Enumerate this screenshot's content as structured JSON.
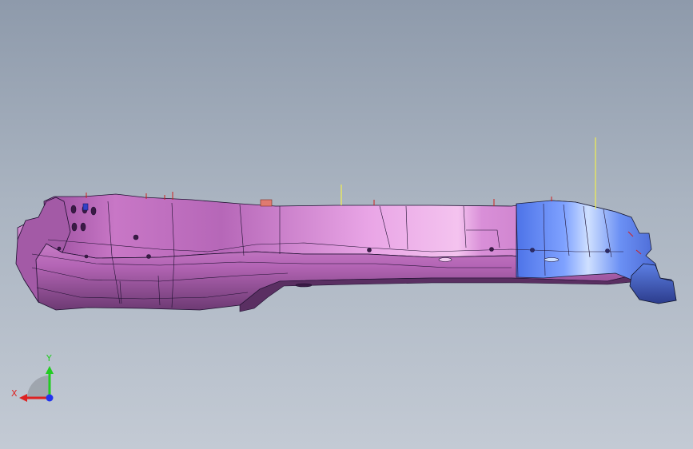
{
  "viewport": {
    "background_top": "#8e9aab",
    "background_bottom": "#c3cad4"
  },
  "model": {
    "body_color": "#cc77cc",
    "highlight_color": "#f2b8f0",
    "end_part_color": "#5f86f0",
    "edge_color": "#1e1030",
    "datum_line_color": "#f2f050",
    "marker_color": "#d02020"
  },
  "triad": {
    "y_label": "Y",
    "x_label": "X",
    "y_color": "#22cc22",
    "x_color": "#dd2222",
    "z_color": "#2233ee"
  }
}
